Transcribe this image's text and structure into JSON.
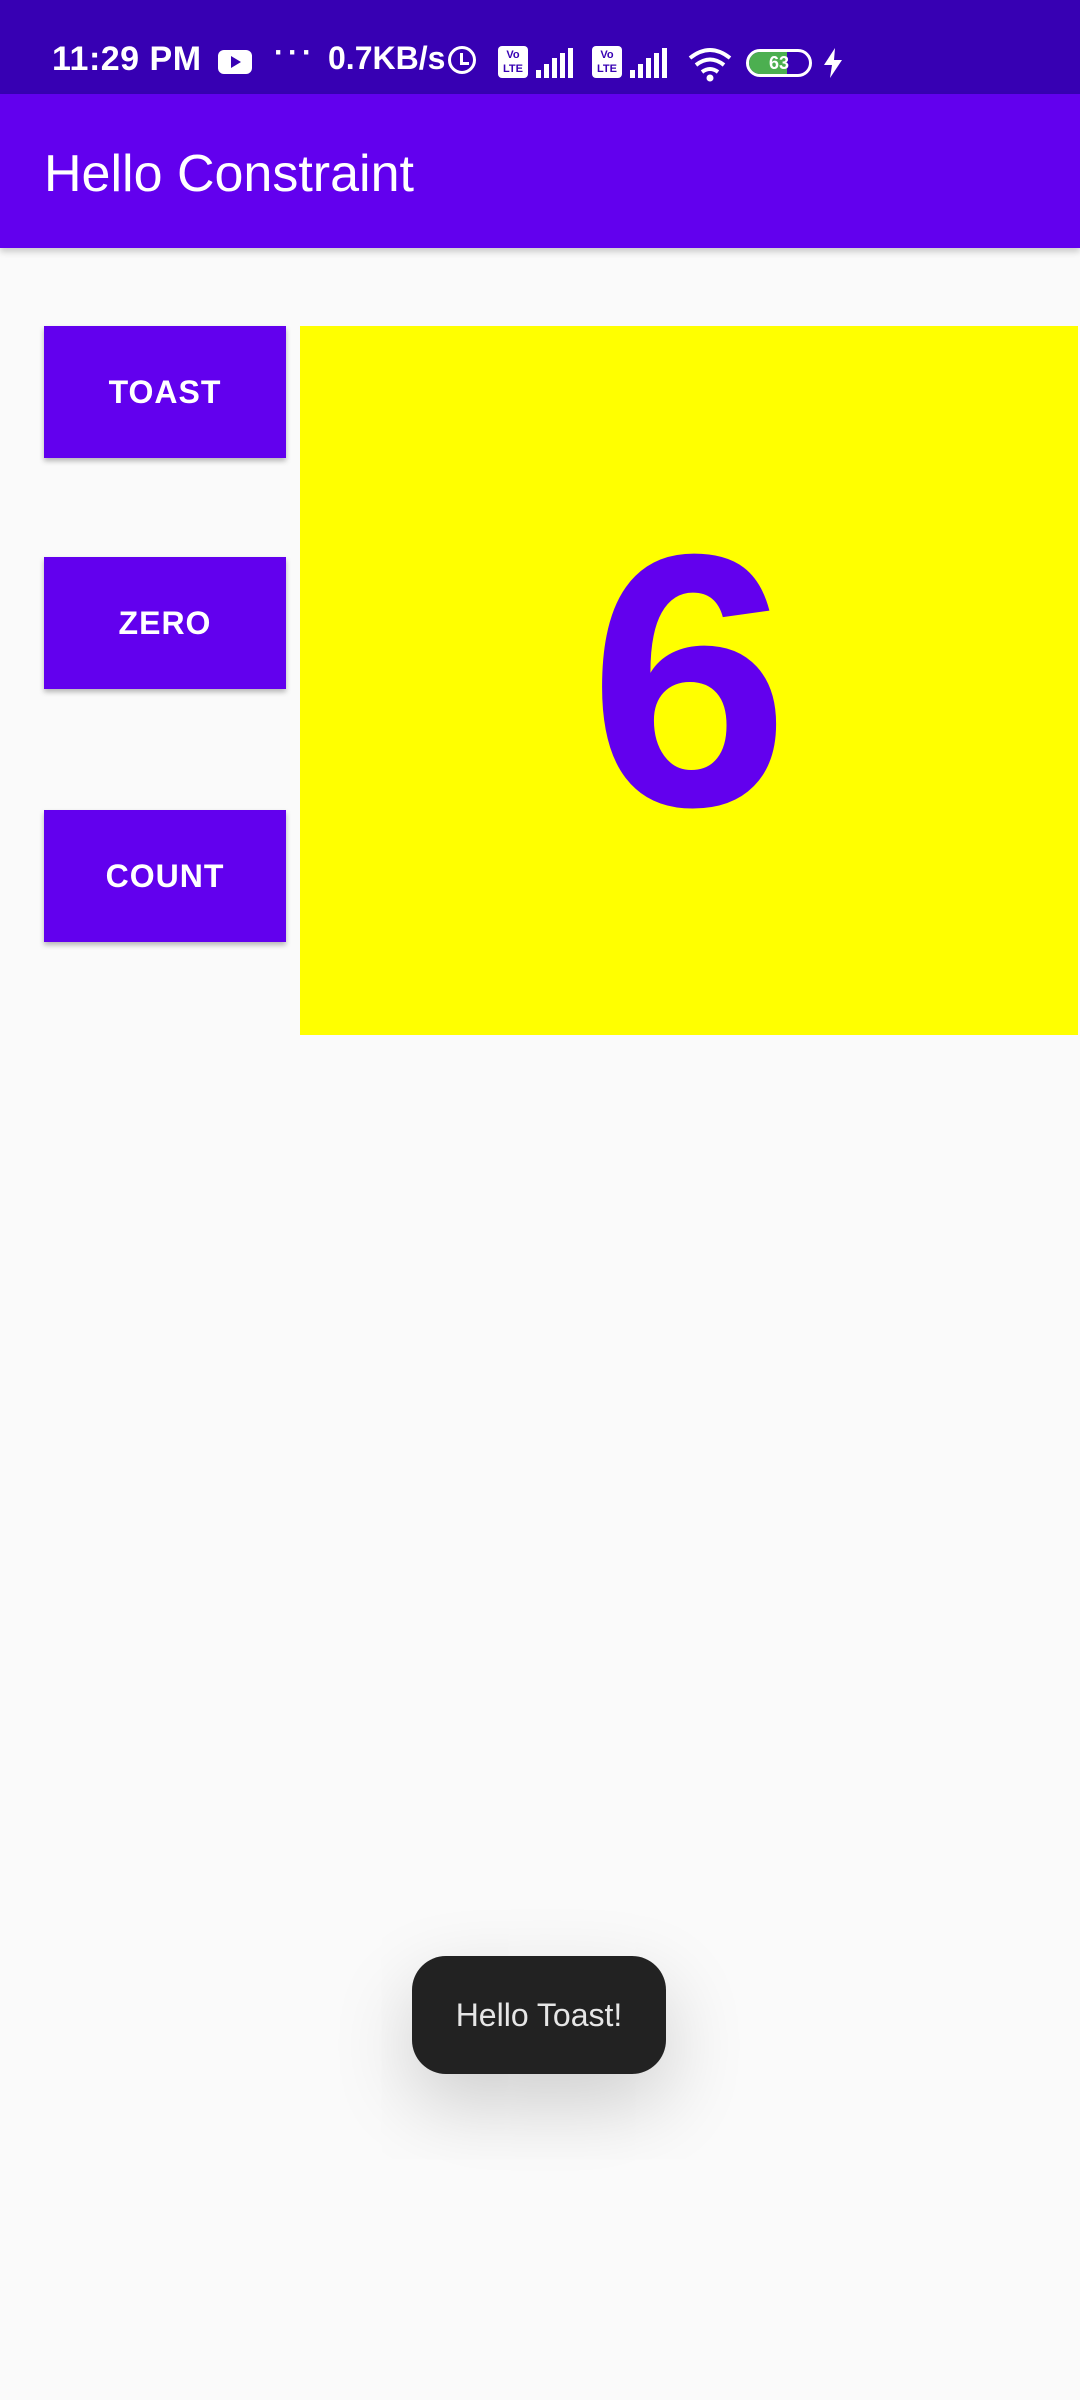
{
  "status_bar": {
    "time": "11:29 PM",
    "notification_dots": "···",
    "network_speed": "0.7KB/s",
    "volte_label_1": "Vo LTE",
    "volte_label_2": "Vo LTE",
    "battery_level": "63",
    "battery_fraction": 0.63,
    "icons": [
      "youtube-icon",
      "alarm-icon",
      "volte-icon",
      "signal-icon",
      "volte-icon",
      "signal-icon",
      "wifi-icon",
      "battery-icon",
      "charging-icon"
    ]
  },
  "app_bar": {
    "title": "Hello Constraint"
  },
  "buttons": {
    "toast": "TOAST",
    "zero": "ZERO",
    "count": "COUNT"
  },
  "counter": {
    "value": "6"
  },
  "toast": {
    "message": "Hello Toast!"
  },
  "colors": {
    "status_bar": "#3700B3",
    "primary": "#6200EE",
    "counter_background": "#FFFF00",
    "page_background": "#FAFAFA",
    "toast_background": "#222222"
  }
}
